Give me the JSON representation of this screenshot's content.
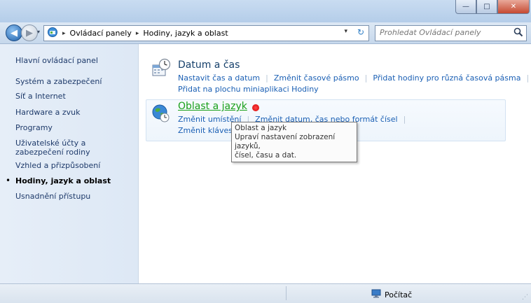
{
  "window": {
    "minimize_glyph": "—",
    "maximize_glyph": "□",
    "close_glyph": "✕"
  },
  "navbar": {
    "back_glyph": "◀",
    "forward_glyph": "▶",
    "recent_glyph": "▾",
    "breadcrumbs": [
      "Ovládací panely",
      "Hodiny, jazyk a oblast"
    ],
    "crumb_separator": "▸",
    "dropdown_glyph": "▾",
    "refresh_glyph": "↻"
  },
  "search": {
    "placeholder": "Prohledat Ovládací panely",
    "icon": "search-icon"
  },
  "sidebar": {
    "items": [
      {
        "label": "Hlavní ovládací panel"
      },
      {
        "label": "Systém a zabezpečení"
      },
      {
        "label": "Síť a Internet"
      },
      {
        "label": "Hardware a zvuk"
      },
      {
        "label": "Programy"
      },
      {
        "label": "Uživatelské účty a zabezpečení rodiny"
      },
      {
        "label": "Vzhled a přizpůsobení"
      },
      {
        "label": "Hodiny, jazyk a oblast",
        "active": true
      },
      {
        "label": "Usnadnění přístupu"
      }
    ],
    "bullet": "•"
  },
  "categories": [
    {
      "title": "Datum a čas",
      "icon": "clock-calendar-icon",
      "rows": [
        [
          "Nastavit čas a datum",
          "Změnit časové pásmo",
          "Přidat hodiny pro různá časová pásma"
        ],
        [
          "Přidat na plochu miniaplikaci Hodiny"
        ]
      ]
    },
    {
      "title": "Oblast a jazyk",
      "icon": "globe-clock-icon",
      "rows": [
        [
          "Změnit umístění",
          "Změnit datum, čas nebo formát čísel"
        ],
        [
          "Změnit klávesnice"
        ]
      ]
    }
  ],
  "tooltip": {
    "title": "Oblast a jazyk",
    "line1": "Upraví nastavení zobrazení jazyků,",
    "line2": "čísel, času a dat."
  },
  "status": {
    "computer_label": "Počítač",
    "computer_icon": "computer-icon"
  },
  "colors": {
    "link": "#1a5fb4",
    "title": "#16406b",
    "hover_title": "#19a019"
  }
}
